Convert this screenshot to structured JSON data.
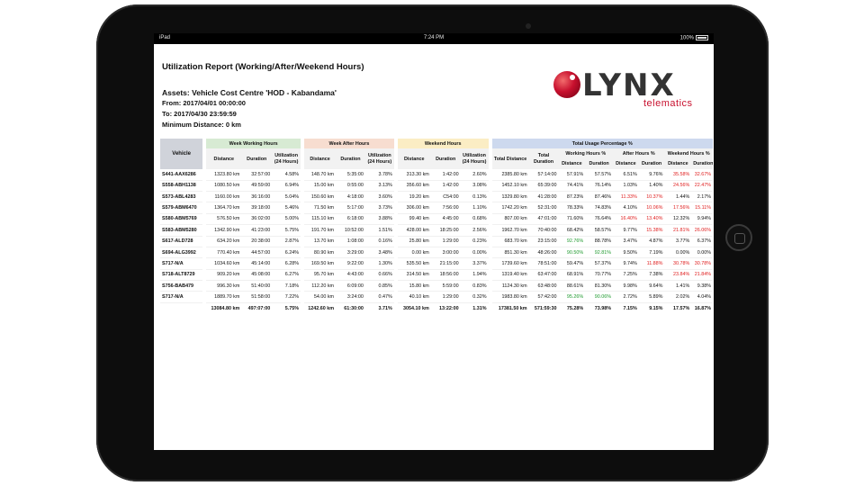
{
  "statusbar": {
    "carrier": "iPad",
    "time": "7:24 PM",
    "battery": "100%"
  },
  "report": {
    "title": "Utilization Report (Working/After/Weekend Hours)",
    "asset": "Assets: Vehicle Cost Centre 'HOD - Kabandama'",
    "from": "From: 2017/04/01 00:00:00",
    "to": "To: 2017/04/30 23:59:59",
    "min_distance": "Minimum Distance: 0 km"
  },
  "logo": {
    "name": "LYNX",
    "sub": "telematics"
  },
  "table": {
    "group_headers": {
      "vehicle": "Vehicle",
      "week": "Week Working Hours",
      "after": "Week After Hours",
      "weekend": "Weekend Hours",
      "total": "Total Usage Percentage %",
      "working_pct": "Working Hours %",
      "after_pct": "After Hours %",
      "weekend_pct": "Weekend Hours %"
    },
    "sub_headers": {
      "distance": "Distance",
      "duration": "Duration",
      "utilization": "Utilization (24 Hours)",
      "total_distance": "Total Distance",
      "total_duration": "Total Duration"
    },
    "rows": [
      [
        "S441-AAX6286",
        "1323.80 km",
        "32:57:00",
        "4.58%",
        "148.70 km",
        "5:35:00",
        "3.78%",
        "313.30 km",
        "1:42:00",
        "2.60%",
        "2385.80 km",
        "57:14:00",
        "57.91%",
        "57.57%",
        "6.51%",
        "9.76%",
        "35.58%",
        "32.67%"
      ],
      [
        "S558-ABH1138",
        "1080.50 km",
        "49:59:00",
        "6.94%",
        "15.00 km",
        "0:55:00",
        "3.13%",
        "356.60 km",
        "1:42:00",
        "3.08%",
        "1452.10 km",
        "65:39:00",
        "74.41%",
        "76.14%",
        "1.03%",
        "1.40%",
        "24.56%",
        "22.47%"
      ],
      [
        "S573-ABL4283",
        "1160.00 km",
        "36:16:00",
        "5.04%",
        "150.60 km",
        "4:18:00",
        "3.60%",
        "19.20 km",
        "C54:00",
        "0.13%",
        "1329.80 km",
        "41:28:00",
        "87.23%",
        "87.46%",
        "11.33%",
        "10.37%",
        "1.44%",
        "2.17%"
      ],
      [
        "S579-ABM6470",
        "1364.70 km",
        "39:18:00",
        "5.46%",
        "71.50 km",
        "5:17:00",
        "3.73%",
        "306.00 km",
        "7:56:00",
        "1.10%",
        "1742.20 km",
        "52:31:00",
        "78.33%",
        "74.83%",
        "4.10%",
        "10.06%",
        "17.56%",
        "15.11%"
      ],
      [
        "S580-ABM5769",
        "576.50 km",
        "36:02:00",
        "5.00%",
        "115.10 km",
        "6:18:00",
        "3.88%",
        "99.40 km",
        "4:45:00",
        "0.68%",
        "807.00 km",
        "47:01:00",
        "71.60%",
        "76.64%",
        "16.40%",
        "13.40%",
        "12.32%",
        "9.94%"
      ],
      [
        "S583-ABM5280",
        "1342.90 km",
        "41:23:00",
        "5.75%",
        "191.70 km",
        "10:52:00",
        "1.51%",
        "428.00 km",
        "18:25:00",
        "2.56%",
        "1962.70 km",
        "70:40:00",
        "68.42%",
        "58.57%",
        "9.77%",
        "15.38%",
        "21.81%",
        "26.06%"
      ],
      [
        "S617-ALD728",
        "634.20 km",
        "20:38:00",
        "2.87%",
        "13.70 km",
        "1:08:00",
        "0.16%",
        "25.80 km",
        "1:29:00",
        "0.23%",
        "683.70 km",
        "23:15:00",
        "92.76%",
        "88.78%",
        "3.47%",
        "4.87%",
        "3.77%",
        "6.37%"
      ],
      [
        "S694-ALG3992",
        "770.40 km",
        "44:57:00",
        "6.24%",
        "80.90 km",
        "3:29:00",
        "3.48%",
        "0.00 km",
        "3:00:00",
        "0.00%",
        "851.30 km",
        "48:26:00",
        "90.50%",
        "92.81%",
        "9.50%",
        "7.19%",
        "0.00%",
        "0.00%"
      ],
      [
        "S717-N/A",
        "1034.60 km",
        "45:14:00",
        "6.28%",
        "169.50 km",
        "9:22:00",
        "1.30%",
        "535.50 km",
        "21:15:00",
        "3.37%",
        "1739.60 km",
        "78:51:00",
        "59.47%",
        "57.37%",
        "9.74%",
        "11.88%",
        "30.78%",
        "30.78%"
      ],
      [
        "S718-ALT8729",
        "909.20 km",
        "45:08:00",
        "6.27%",
        "95.70 km",
        "4:43:00",
        "0.66%",
        "314.50 km",
        "18:56:00",
        "1.94%",
        "1319.40 km",
        "63:47:00",
        "68.91%",
        "70.77%",
        "7.25%",
        "7.38%",
        "23.84%",
        "21.84%"
      ],
      [
        "S756-BAB479",
        "996.30 km",
        "51:40:00",
        "7.18%",
        "112.20 km",
        "6:09:00",
        "0.85%",
        "15.80 km",
        "5:59:00",
        "0.83%",
        "1124.30 km",
        "63:48:00",
        "88.61%",
        "81.30%",
        "9.98%",
        "9.64%",
        "1.41%",
        "9.38%"
      ],
      [
        "S717-N/A",
        "1889.70 km",
        "51:58:00",
        "7.22%",
        "54.00 km",
        "3:24:00",
        "0.47%",
        "40.10 km",
        "1:29:00",
        "0.32%",
        "1983.80 km",
        "57:42:00",
        "95.26%",
        "90.06%",
        "2.72%",
        "5.89%",
        "2.02%",
        "4.04%"
      ]
    ],
    "totals": [
      "",
      "13084.80 km",
      "497:07:00",
      "5.75%",
      "1242.60 km",
      "61:30:00",
      "3.71%",
      "3054.10 km",
      "13:22:00",
      "1.31%",
      "17381.50 km",
      "571:59:30",
      "75.28%",
      "73.98%",
      "7.15%",
      "9.15%",
      "17.57%",
      "16.87%"
    ],
    "colors": {
      "red_cells": [
        "0-16",
        "0-17",
        "1-16",
        "1-17",
        "2-14",
        "2-15",
        "3-15",
        "3-16",
        "3-17",
        "4-14",
        "4-15",
        "5-15",
        "5-16",
        "5-17",
        "8-15",
        "8-16",
        "8-17",
        "9-16",
        "9-17"
      ],
      "green_cells": [
        "6-12",
        "7-12",
        "7-13",
        "11-12",
        "11-13"
      ],
      "red": "#e01d1d",
      "green": "#1e9a2e"
    }
  }
}
